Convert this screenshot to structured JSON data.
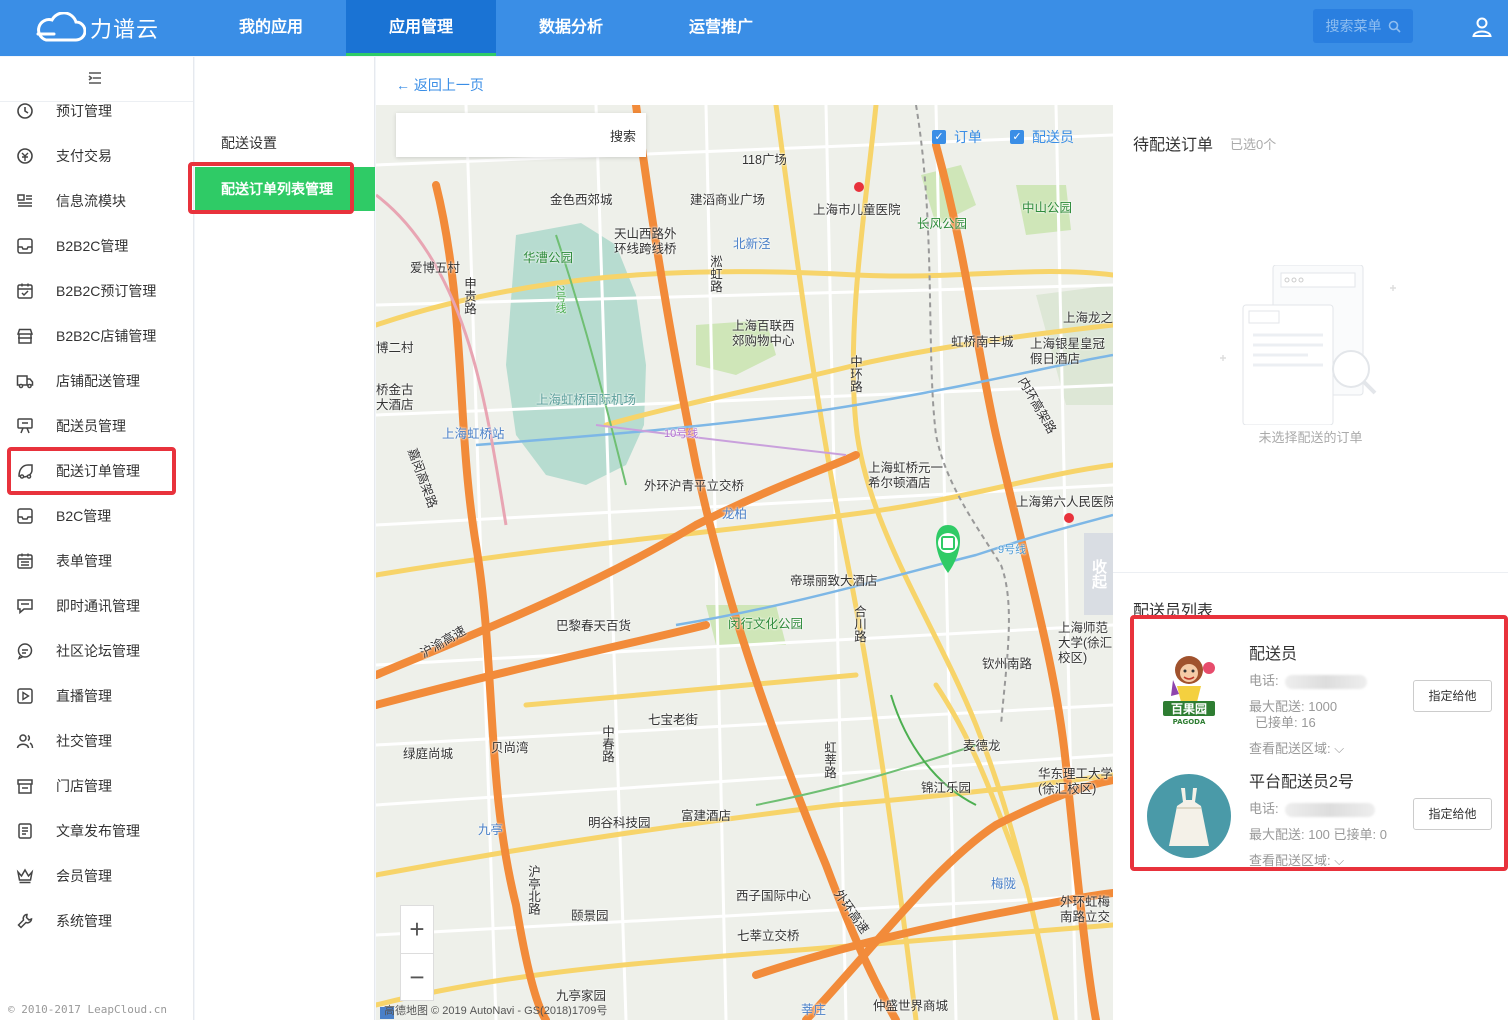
{
  "header": {
    "logo_text": "力谱云",
    "nav": [
      {
        "label": "我的应用"
      },
      {
        "label": "应用管理",
        "active": true
      },
      {
        "label": "数据分析"
      },
      {
        "label": "运营推广"
      }
    ],
    "search_label": "搜索菜单"
  },
  "sidebar": {
    "items": [
      {
        "label": "预订管理",
        "icon": "clock-icon"
      },
      {
        "label": "支付交易",
        "icon": "payment-icon"
      },
      {
        "label": "信息流模块",
        "icon": "feed-icon"
      },
      {
        "label": "B2B2C管理",
        "icon": "inbox-icon"
      },
      {
        "label": "B2B2C预订管理",
        "icon": "calendar-check-icon"
      },
      {
        "label": "B2B2C店铺管理",
        "icon": "shop-icon"
      },
      {
        "label": "店铺配送管理",
        "icon": "truck-icon"
      },
      {
        "label": "配送员管理",
        "icon": "courier-icon"
      },
      {
        "label": "配送订单管理",
        "icon": "delivery-order-icon"
      },
      {
        "label": "B2C管理",
        "icon": "inbox-icon"
      },
      {
        "label": "表单管理",
        "icon": "form-icon"
      },
      {
        "label": "即时通讯管理",
        "icon": "chat-icon"
      },
      {
        "label": "社区论坛管理",
        "icon": "forum-icon"
      },
      {
        "label": "直播管理",
        "icon": "play-icon"
      },
      {
        "label": "社交管理",
        "icon": "users-icon"
      },
      {
        "label": "门店管理",
        "icon": "store-icon"
      },
      {
        "label": "文章发布管理",
        "icon": "article-icon"
      },
      {
        "label": "会员管理",
        "icon": "crown-icon"
      },
      {
        "label": "系统管理",
        "icon": "wrench-icon"
      }
    ],
    "copyright": "© 2010-2017 LeapCloud.cn"
  },
  "submenu": {
    "items": [
      {
        "label": "配送设置"
      },
      {
        "label": "配送订单列表管理",
        "active": true
      }
    ]
  },
  "content": {
    "back_label": "← 返回上一页"
  },
  "map": {
    "search_placeholder": "",
    "search_button": "搜索",
    "checks": [
      {
        "label": "订单",
        "checked": true
      },
      {
        "label": "配送员",
        "checked": true
      }
    ],
    "collapse_label": "收起",
    "credit": "高德地图 © 2019 AutoNavi - GS(2018)1709号",
    "labels": [
      {
        "text": "118广场"
      },
      {
        "text": "金色西郊城"
      },
      {
        "text": "建滔商业广场"
      },
      {
        "text": "上海市儿童医院"
      },
      {
        "text": "长风公园"
      },
      {
        "text": "中山公园"
      },
      {
        "text": "天山西路外环线跨线桥"
      },
      {
        "text": "北新泾"
      },
      {
        "text": "华漕公园"
      },
      {
        "text": "爱博五村"
      },
      {
        "text": "上海百联西郊购物中心"
      },
      {
        "text": "虹桥南丰城"
      },
      {
        "text": "上海银星皇冠假日酒店"
      },
      {
        "text": "上海龙之"
      },
      {
        "text": "博二村"
      },
      {
        "text": "桥金古大酒店"
      },
      {
        "text": "上海虹桥国际机场"
      },
      {
        "text": "上海虹桥站"
      },
      {
        "text": "上海虹桥元一希尔顿酒店"
      },
      {
        "text": "上海第六人民医院"
      },
      {
        "text": "外环沪青平立交桥"
      },
      {
        "text": "龙柏"
      },
      {
        "text": "帝璟丽致大酒店"
      },
      {
        "text": "巴黎春天百货"
      },
      {
        "text": "闵行文化公园"
      },
      {
        "text": "上海师范大学(徐汇校区)"
      },
      {
        "text": "钦州南路"
      },
      {
        "text": "七宝老街"
      },
      {
        "text": "绿庭尚城"
      },
      {
        "text": "贝尚湾"
      },
      {
        "text": "麦德龙"
      },
      {
        "text": "锦江乐园"
      },
      {
        "text": "华东理工大学(徐汇校区)"
      },
      {
        "text": "九亭"
      },
      {
        "text": "明谷科技园"
      },
      {
        "text": "富建酒店"
      },
      {
        "text": "梅陇"
      },
      {
        "text": "西子国际中心"
      },
      {
        "text": "颐景园"
      },
      {
        "text": "七莘立交桥"
      },
      {
        "text": "外环虹梅南路立交"
      },
      {
        "text": "九亭家园"
      },
      {
        "text": "莘庄"
      },
      {
        "text": "仲盛世界商城"
      },
      {
        "text": "中环路"
      },
      {
        "text": "内环高架路"
      },
      {
        "text": "外环高速"
      },
      {
        "text": "沪渝高速"
      },
      {
        "text": "嘉闵高架路"
      },
      {
        "text": "申贵路"
      },
      {
        "text": "淞虹路"
      },
      {
        "text": "合川路"
      },
      {
        "text": "虹莘路"
      },
      {
        "text": "中春路"
      },
      {
        "text": "沪亭北路"
      },
      {
        "text": "2号线"
      },
      {
        "text": "9号线"
      },
      {
        "text": "10号线"
      }
    ]
  },
  "panel": {
    "pending_title": "待配送订单",
    "pending_count": "已选0个",
    "empty_text": "未选择配送的订单",
    "courier_title": "配送员列表",
    "couriers": [
      {
        "name": "配送员",
        "phone_label": "电话:",
        "max_label": "最大配送: 1000",
        "taken_label": "已接单: 16",
        "area_label": "查看配送区域:",
        "assign_label": "指定给他",
        "avatar_text": "百果园",
        "avatar_sub": "PAGODA"
      },
      {
        "name": "平台配送员2号",
        "phone_label": "电话:",
        "max_label": "最大配送: 100 已接单: 0",
        "area_label": "查看配送区域:",
        "assign_label": "指定给他"
      }
    ]
  },
  "colors": {
    "brand_blue": "#3a8ee6",
    "active_green": "#2fcb66",
    "annotation_red": "#e8323c"
  }
}
